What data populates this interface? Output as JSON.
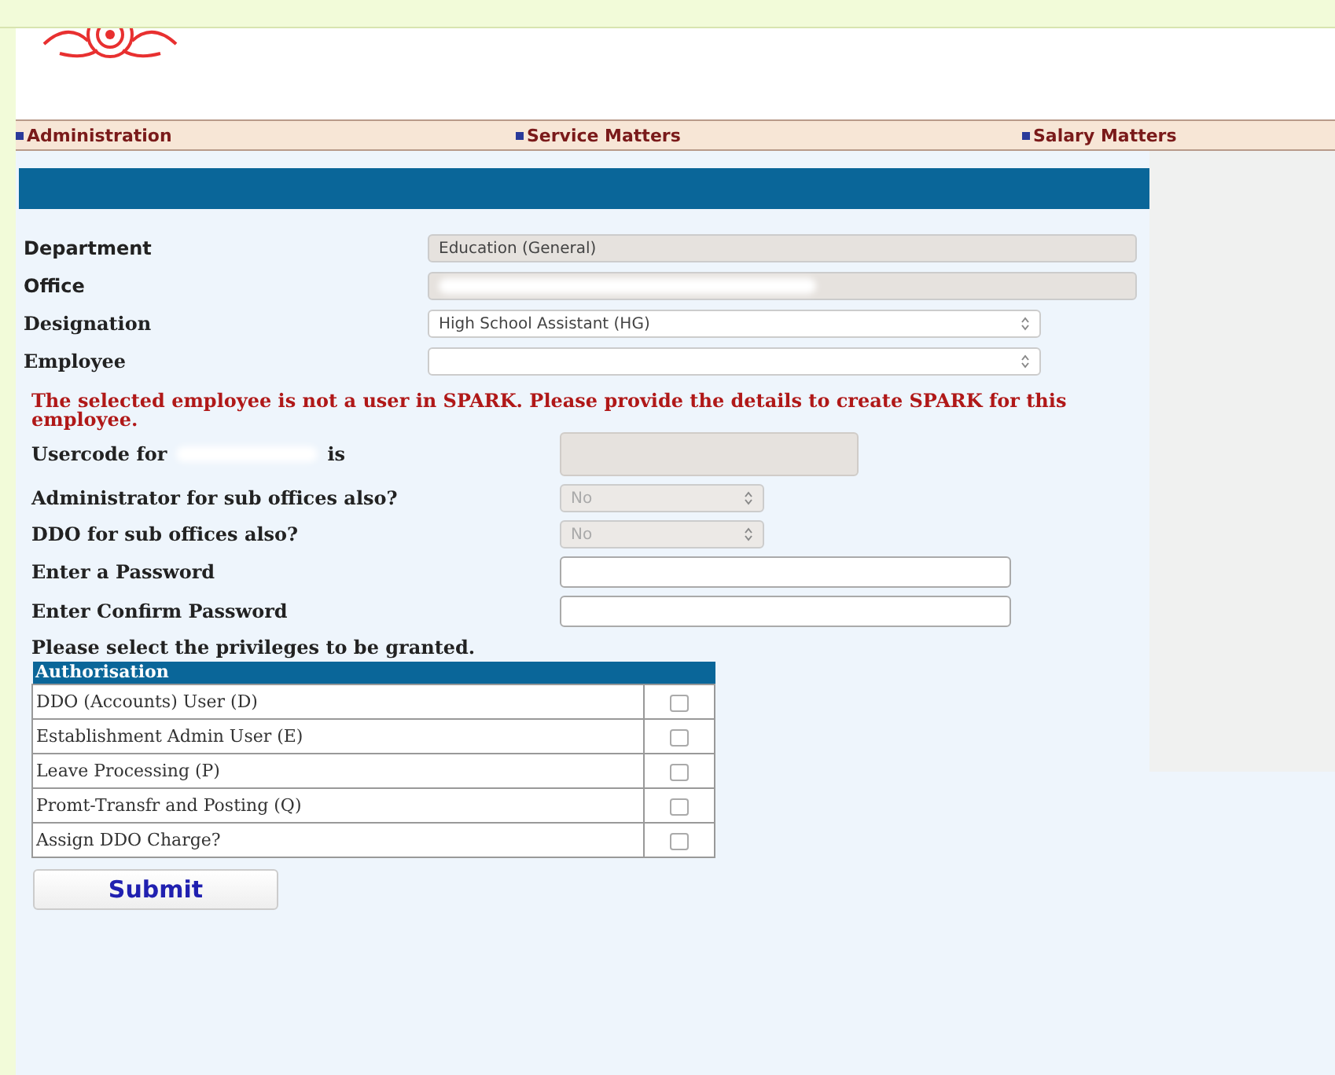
{
  "menu": [
    {
      "label": "Administration"
    },
    {
      "label": "Service Matters"
    },
    {
      "label": "Salary Matters"
    }
  ],
  "fields": [
    {
      "label": "Department",
      "kind": "readonly",
      "value": "Education (General)"
    },
    {
      "label": "Office",
      "kind": "readonly"
    },
    {
      "label": "Designation",
      "kind": "select",
      "value": "High School Assistant (HG)"
    },
    {
      "label": "Employee",
      "kind": "select"
    }
  ],
  "error": "The selected employee is not a user in SPARK. Please provide the details to create SPARK for this employee.",
  "user_fields": [
    {
      "kind": "usercode",
      "label": "Usercode for",
      "suffix": "is"
    },
    {
      "kind": "select",
      "label": "Administrator for sub offices also?",
      "value": "No",
      "disabled": true
    },
    {
      "kind": "select",
      "label": "DDO for sub offices also?",
      "value": "No",
      "disabled": true
    },
    {
      "kind": "password",
      "label": "Enter a Password"
    },
    {
      "kind": "password",
      "label": "Enter Confirm Password"
    }
  ],
  "privileges_prompt": "Please select the privileges to be granted.",
  "privileges": {
    "header": "Authorisation",
    "rows": [
      {
        "label": "DDO (Accounts) User (D)",
        "checked": false
      },
      {
        "label": "Establishment Admin User (E)",
        "checked": false
      },
      {
        "label": "Leave Processing (P)",
        "checked": false
      },
      {
        "label": "Promt-Transfr and Posting (Q)",
        "checked": false
      },
      {
        "label": "Assign DDO Charge?",
        "checked": false
      }
    ]
  },
  "submit": "Submit"
}
